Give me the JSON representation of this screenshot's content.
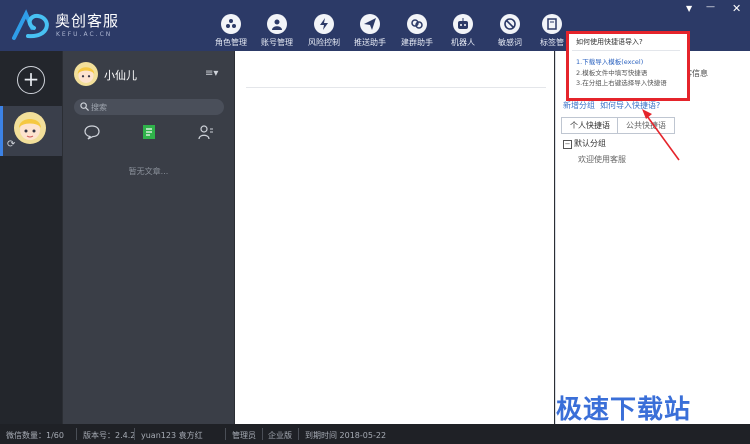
{
  "app": {
    "name_cn": "奥创客服",
    "name_en": "KEFU.AC.CN"
  },
  "nav": [
    {
      "label": "角色管理",
      "icon": "role-icon"
    },
    {
      "label": "账号管理",
      "icon": "account-icon"
    },
    {
      "label": "风险控制",
      "icon": "lightning-icon"
    },
    {
      "label": "推送助手",
      "icon": "send-icon"
    },
    {
      "label": "建群助手",
      "icon": "group-icon"
    },
    {
      "label": "机器人",
      "icon": "robot-icon"
    },
    {
      "label": "敏感词",
      "icon": "forbidden-icon"
    },
    {
      "label": "标签管",
      "icon": "tag-icon"
    }
  ],
  "window": {
    "menu": "▼",
    "minimize": "—",
    "close": "✕"
  },
  "rail": {
    "add": "+",
    "sync": "⟳"
  },
  "contact": {
    "name": "小仙儿",
    "menu": "≡▾",
    "search_placeholder": "搜索",
    "empty": "暂无文章..."
  },
  "right": {
    "extra_tab": "客信息",
    "add_group": "新增分组",
    "how_import": "如何导入快捷语?",
    "tab_personal": "个人快捷语",
    "tab_public": "公共快捷语",
    "group_toggle": "−",
    "group_name": "默认分组",
    "group_item": "欢迎使用客服"
  },
  "popup": {
    "title": "如何使用快捷语导入?",
    "step1": "1.下载导入模板(excel)",
    "step2": "2.模板文件中填写快捷语",
    "step3": "3.在分组上右键选择导入快捷语"
  },
  "status": [
    "微信数量：1/60",
    "版本号：2.4.2",
    "yuan123 袁方红",
    "管理员",
    "企业版",
    "到期时间 2018-05-22"
  ],
  "watermark": "极速下载站",
  "colors": {
    "topbar": "#2c3a67",
    "accent": "#3b73c8",
    "highlight": "#e5242b"
  }
}
